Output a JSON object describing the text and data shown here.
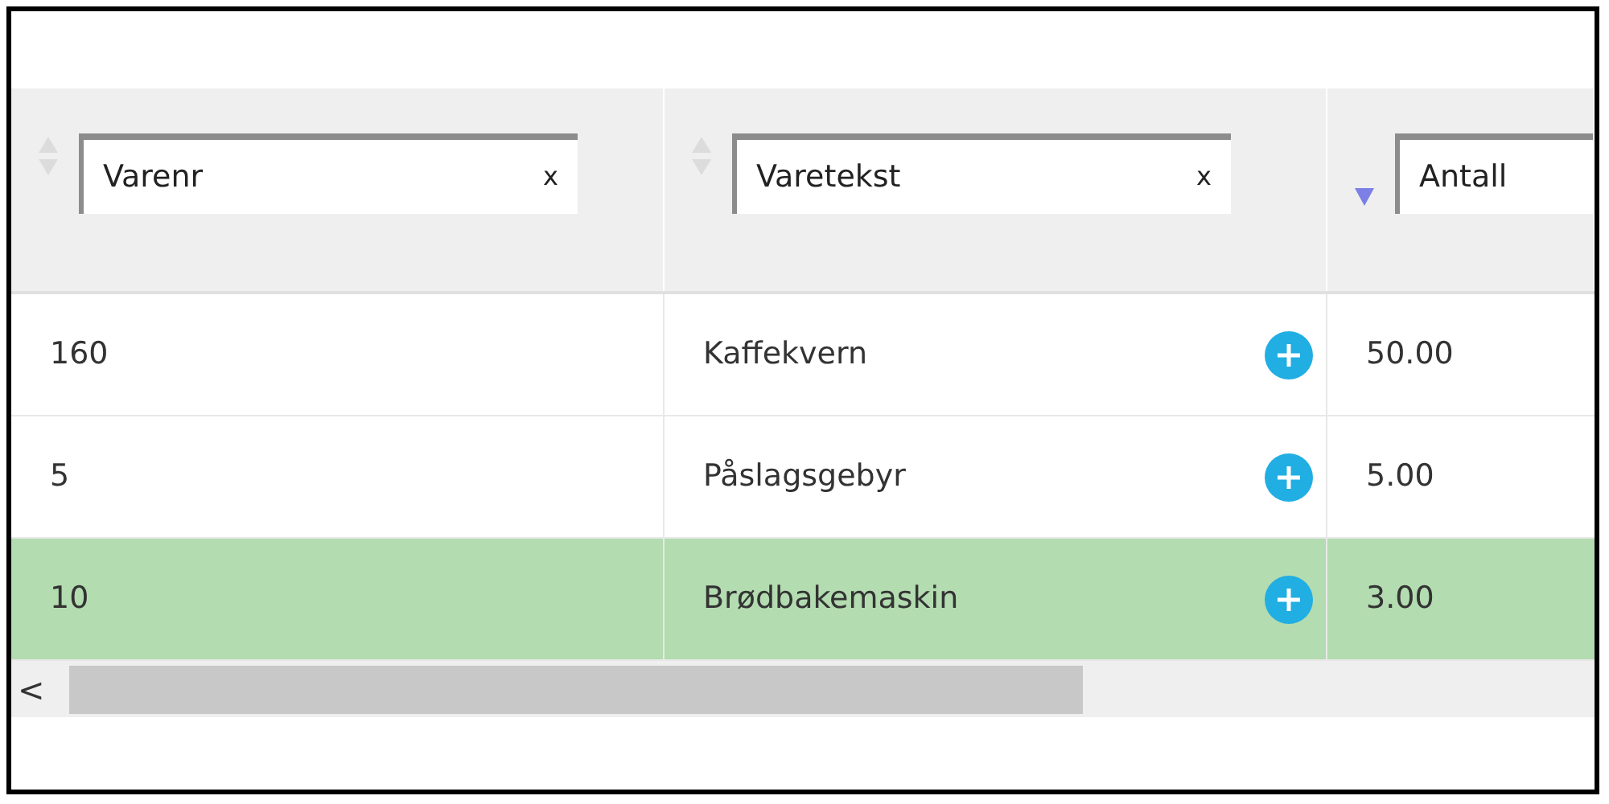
{
  "columns": [
    {
      "filter": "Varenr",
      "clear": "x",
      "sorted": false
    },
    {
      "filter": "Varetekst",
      "clear": "x",
      "sorted": false
    },
    {
      "filter": "Antall",
      "sorted": true
    }
  ],
  "rows": [
    {
      "cells": [
        "160",
        "Kaffekvern",
        "50.00"
      ],
      "selected": false
    },
    {
      "cells": [
        "5",
        "Påslagsgebyr",
        "5.00"
      ],
      "selected": false
    },
    {
      "cells": [
        "10",
        "Brødbakemaskin",
        "3.00"
      ],
      "selected": true
    }
  ],
  "scrollbar": {
    "left": "<"
  }
}
